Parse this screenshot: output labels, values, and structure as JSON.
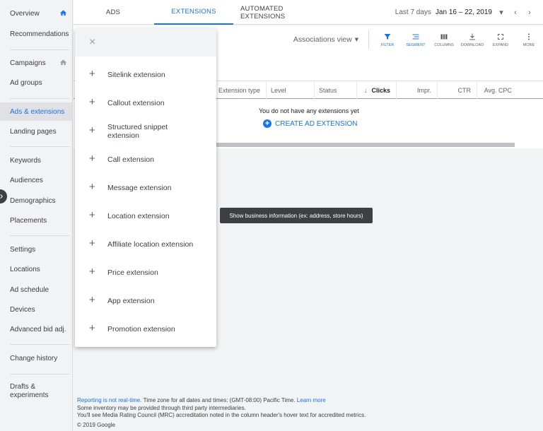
{
  "sidebar": {
    "items": [
      {
        "label": "Overview",
        "home": true
      },
      {
        "label": "Recommendations"
      },
      {
        "label": "Campaigns",
        "home": true
      },
      {
        "label": "Ad groups"
      },
      {
        "label": "Ads & extensions",
        "active": true
      },
      {
        "label": "Landing pages"
      },
      {
        "label": "Keywords"
      },
      {
        "label": "Audiences"
      },
      {
        "label": "Demographics"
      },
      {
        "label": "Placements"
      },
      {
        "label": "Settings"
      },
      {
        "label": "Locations"
      },
      {
        "label": "Ad schedule"
      },
      {
        "label": "Devices"
      },
      {
        "label": "Advanced bid adj."
      },
      {
        "label": "Change history"
      },
      {
        "label": "Drafts & experiments"
      }
    ]
  },
  "tabs": [
    {
      "label": "ADS"
    },
    {
      "label": "EXTENSIONS",
      "active": true
    },
    {
      "label": "AUTOMATED EXTENSIONS"
    }
  ],
  "daterange": {
    "label": "Last 7 days",
    "value": "Jan 16 – 22, 2019"
  },
  "toolbar": {
    "associations_view": "Associations view",
    "tools": [
      {
        "label": "FILTER",
        "icon": "filter-icon"
      },
      {
        "label": "SEGMENT",
        "icon": "segment-icon"
      },
      {
        "label": "COLUMNS",
        "icon": "columns-icon"
      },
      {
        "label": "DOWNLOAD",
        "icon": "download-icon"
      },
      {
        "label": "EXPAND",
        "icon": "expand-icon"
      },
      {
        "label": "MORE",
        "icon": "more-icon"
      }
    ]
  },
  "table": {
    "columns": [
      "Extension type",
      "Level",
      "Status",
      "Clicks",
      "Impr.",
      "CTR",
      "Avg. CPC"
    ],
    "empty_message": "You do not have any extensions yet",
    "create_label": "CREATE AD EXTENSION"
  },
  "menu": {
    "close_symbol": "×",
    "items": [
      "Sitelink extension",
      "Callout extension",
      "Structured snippet extension",
      "Call extension",
      "Message extension",
      "Location extension",
      "Affiliate location extension",
      "Price extension",
      "App extension",
      "Promotion extension"
    ]
  },
  "tooltip": "Show business information (ex: address, store hours)",
  "footer": {
    "not_realtime_link": "Reporting is not real-time.",
    "timezone_text": " Time zone for all dates and times: (GMT-08:00) Pacific Time. ",
    "learn_more_link": "Learn more",
    "line2": "Some inventory may be provided through third party intermediaries.",
    "line3": "You'll see Media Rating Council (MRC) accreditation noted in the column header's hover text for accredited metrics.",
    "copyright": "© 2019 Google"
  },
  "colors": {
    "accent": "#1a73e8",
    "sidebar_bg": "#f1f3f4",
    "tooltip_bg": "#3c4043"
  }
}
